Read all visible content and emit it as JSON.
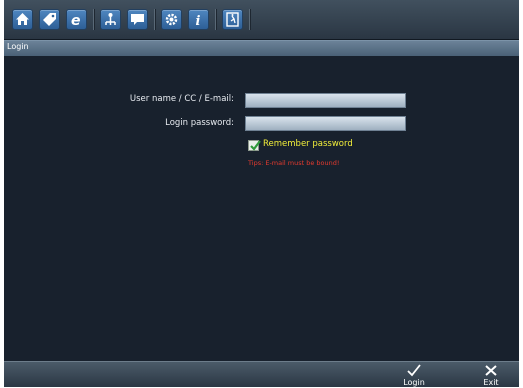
{
  "window": {
    "title": "Login"
  },
  "toolbar": {
    "buttons": [
      {
        "icon": "home-icon"
      },
      {
        "icon": "tag-icon"
      },
      {
        "icon": "internet-explorer-icon"
      },
      {
        "icon": "network-icon"
      },
      {
        "icon": "chat-icon"
      },
      {
        "icon": "settings-icon"
      },
      {
        "icon": "info-icon"
      },
      {
        "icon": "exit-door-icon"
      }
    ]
  },
  "form": {
    "username_label": "User name / CC / E-mail:",
    "username_value": "",
    "password_label": "Login password:",
    "password_value": "",
    "remember_label": "Remember password",
    "remember_checked": true,
    "tips": "Tips: E-mail must be bound!"
  },
  "bottombar": {
    "login_label": "Login",
    "exit_label": "Exit"
  },
  "colors": {
    "background": "#18212d",
    "remember_text": "#f2ee3a",
    "tips_text": "#e43a2e"
  }
}
